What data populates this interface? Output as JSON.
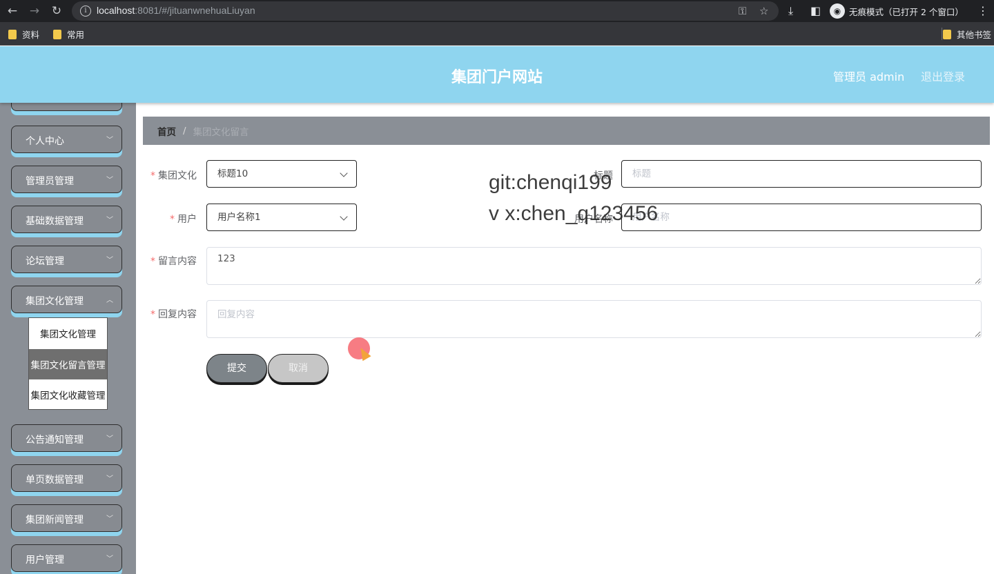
{
  "browser": {
    "url_host": "localhost",
    "url_rest": ":8081/#/jituanwnehuaLiuyan",
    "incognito_label": "无痕模式（已打开 2 个窗口）",
    "bookmarks": [
      "资料",
      "常用"
    ],
    "other_bookmarks": "其他书签"
  },
  "header": {
    "title": "集团门户网站",
    "admin": "管理员 admin",
    "logout": "退出登录"
  },
  "sidebar": {
    "items": [
      "个人中心",
      "管理员管理",
      "基础数据管理",
      "论坛管理",
      "集团文化管理",
      "公告通知管理",
      "单页数据管理",
      "集团新闻管理",
      "用户管理"
    ],
    "submenu": [
      "集团文化管理",
      "集团文化留言管理",
      "集团文化收藏管理"
    ],
    "active_submenu": "集团文化留言管理"
  },
  "breadcrumb": {
    "home": "首页",
    "separator": "/",
    "current": "集团文化留言"
  },
  "form": {
    "culture_label": "集团文化",
    "culture_value": "标题10",
    "title_label": "标题",
    "title_placeholder": "标题",
    "user_label": "用户",
    "user_value": "用户名称1",
    "username_label": "用户名称",
    "username_placeholder": "用户名称",
    "message_label": "留言内容",
    "message_value": "123",
    "reply_label": "回复内容",
    "reply_placeholder": "回复内容",
    "submit": "提交",
    "cancel": "取消"
  },
  "watermark": {
    "line1": "git:chenqi199",
    "line2": "v x:chen_q123456"
  },
  "colors": {
    "header_bg": "#8fd5ef",
    "sidebar_bg": "#8a8f96",
    "required": "#f56c6c"
  }
}
